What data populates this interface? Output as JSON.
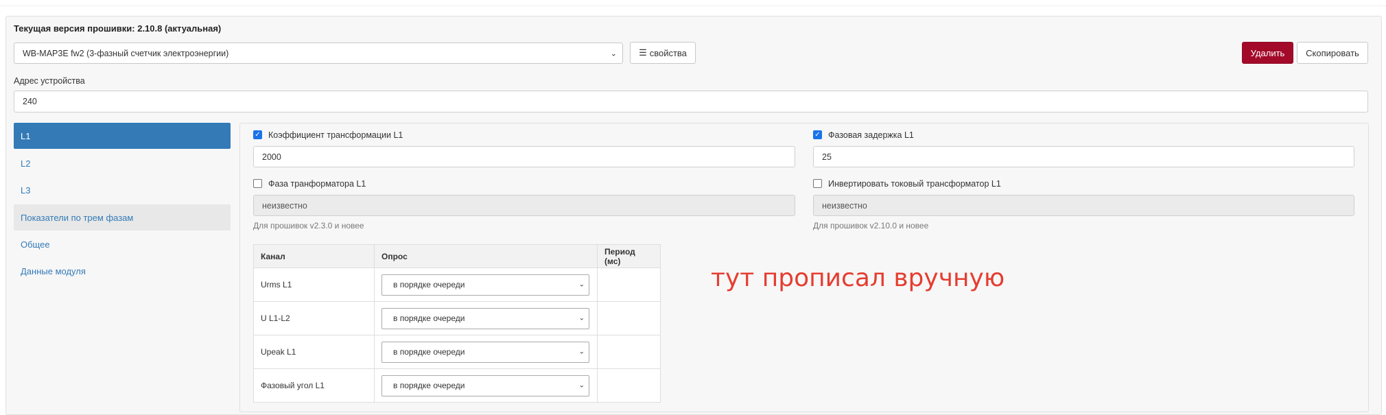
{
  "firmware": {
    "title": "Текущая версия прошивки: 2.10.8 (актуальная)"
  },
  "device_select": {
    "value": "WB-MAP3E fw2 (3-фазный счетчик электроэнергии)"
  },
  "properties_button": {
    "label": "свойства",
    "icon": "list-icon"
  },
  "delete_button": {
    "label": "Удалить",
    "color": "#a30a2a"
  },
  "copy_button": {
    "label": "Скопировать"
  },
  "address": {
    "label": "Адрес устройства",
    "value": "240"
  },
  "nav": {
    "items": [
      {
        "label": "L1"
      },
      {
        "label": "L2"
      },
      {
        "label": "L3"
      },
      {
        "label": "Показатели по трем фазам"
      },
      {
        "label": "Общее"
      },
      {
        "label": "Данные модуля"
      }
    ]
  },
  "form": {
    "ratio": {
      "label": "Коэффициент трансформации L1",
      "value": "2000",
      "checked": true
    },
    "phase_delay": {
      "label": "Фазовая задержка L1",
      "value": "25",
      "checked": true
    },
    "transformer_phase": {
      "label": "Фаза транформатора L1",
      "value": "неизвестно",
      "hint": "Для прошивок v2.3.0 и новее",
      "checked": false
    },
    "invert": {
      "label": "Инвертировать токовый трансформатор L1",
      "value": "неизвестно",
      "hint": "Для прошивок v2.10.0 и новее",
      "checked": false
    }
  },
  "table": {
    "headers": [
      "Канал",
      "Опрос",
      "Период (мс)"
    ],
    "rows": [
      {
        "channel": "Urms L1",
        "poll": "в порядке очереди",
        "period": ""
      },
      {
        "channel": "U L1-L2",
        "poll": "в порядке очереди",
        "period": ""
      },
      {
        "channel": "Upeak L1",
        "poll": "в порядке очереди",
        "period": ""
      },
      {
        "channel": "Фазовый угол L1",
        "poll": "в порядке очереди",
        "period": ""
      }
    ]
  },
  "annotation": {
    "text": "тут прописал вручную",
    "color": "#e53d30"
  },
  "colors": {
    "primary": "#337ab7",
    "danger": "#a30a2a",
    "checkbox": "#1a73e8"
  }
}
